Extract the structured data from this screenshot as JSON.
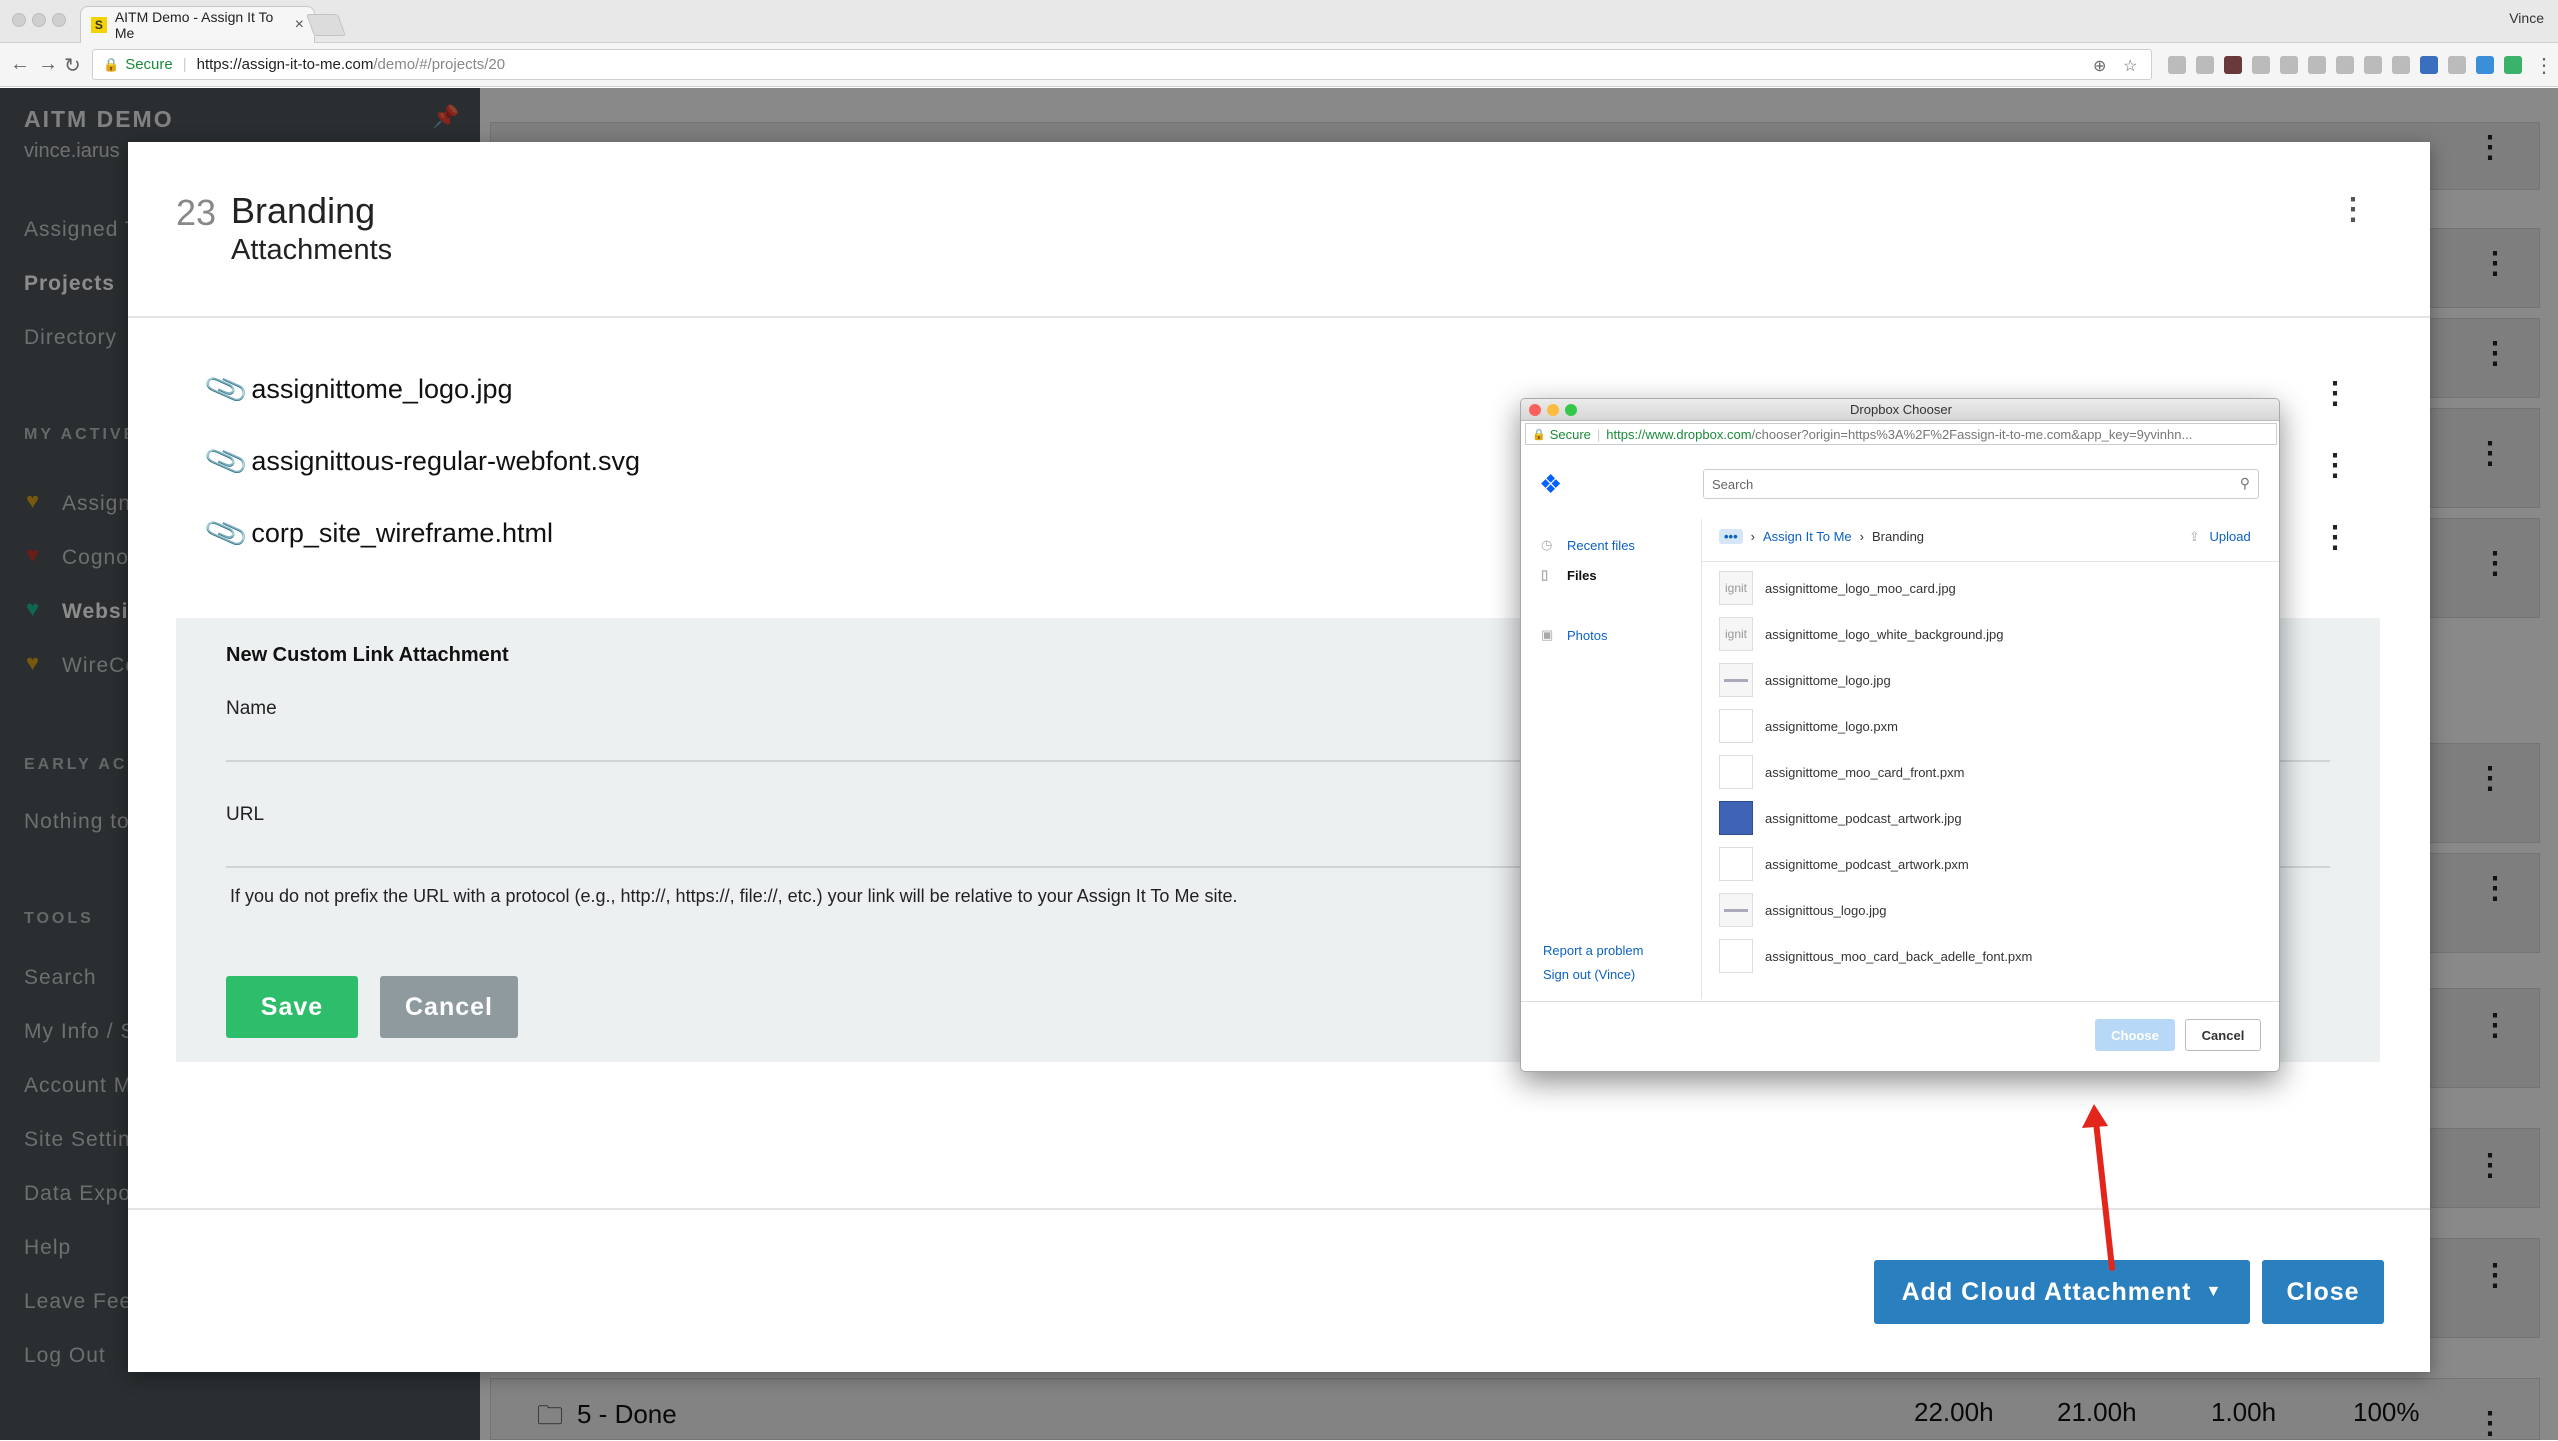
{
  "browser": {
    "tab_title": "AITM Demo - Assign It To Me",
    "tab_favicon": "S",
    "tab_close": "×",
    "profile": "Vince",
    "secure_label": "Secure",
    "url_host": "https://assign-it-to-me.com",
    "url_path": "/demo/#/projects/20"
  },
  "sidebar": {
    "brand": "AITM DEMO",
    "user": "vince.iarus",
    "items": [
      "Assigned T",
      "Projects",
      "Directory"
    ],
    "my_active_heading": "MY ACTIVE",
    "projects": [
      {
        "label": "Assign",
        "color": "#d9a21b"
      },
      {
        "label": "Cogno",
        "color": "#c0392b"
      },
      {
        "label": "Websi",
        "color": "#1abc9c"
      },
      {
        "label": "WireCo",
        "color": "#d9a21b"
      }
    ],
    "early_heading": "EARLY ACC",
    "early_text": "Nothing to",
    "tools_heading": "TOOLS",
    "tools": [
      "Search",
      "My Info / S",
      "Account M",
      "Site Settin",
      "Data Expo",
      "Help",
      "Leave Fee",
      "Log Out"
    ]
  },
  "background": {
    "row_values": [
      "22.00h",
      "21.00h",
      "1.00h",
      "100%"
    ],
    "done_label": "5 - Done"
  },
  "modal": {
    "number": "23",
    "title": "Branding",
    "subtitle": "Attachments",
    "attachments": [
      "assignittome_logo.jpg",
      "assignittous-regular-webfont.svg",
      "corp_site_wireframe.html"
    ],
    "form": {
      "title": "New Custom Link Attachment",
      "name_label": "Name",
      "name_value": "",
      "url_label": "URL",
      "url_value": "",
      "help": "If you do not prefix the URL with a protocol (e.g., http://, https://, file://, etc.) your link will be relative to your Assign It To Me site.",
      "save": "Save",
      "cancel": "Cancel"
    },
    "add_cloud": "Add Cloud Attachment",
    "close": "Close"
  },
  "dropbox": {
    "window_title": "Dropbox Chooser",
    "secure_label": "Secure",
    "url_host": "https://www.dropbox.com",
    "url_path": "/chooser?origin=https%3A%2F%2Fassign-it-to-me.com&app_key=9yvinhn...",
    "search_placeholder": "Search",
    "nav": [
      "Recent files",
      "Files",
      "Photos"
    ],
    "report": "Report a problem",
    "signout": "Sign out (Vince)",
    "crumb_more": "•••",
    "crumb_parent": "Assign It To Me",
    "crumb_current": "Branding",
    "upload": "Upload",
    "files": [
      {
        "name": "assignittome_logo_moo_card.jpg",
        "thumb": "ignit"
      },
      {
        "name": "assignittome_logo_white_background.jpg",
        "thumb": "ignit"
      },
      {
        "name": "assignittome_logo.jpg",
        "thumb": ""
      },
      {
        "name": "assignittome_logo.pxm",
        "thumb": ""
      },
      {
        "name": "assignittome_moo_card_front.pxm",
        "thumb": ""
      },
      {
        "name": "assignittome_podcast_artwork.jpg",
        "thumb": ""
      },
      {
        "name": "assignittome_podcast_artwork.pxm",
        "thumb": ""
      },
      {
        "name": "assignittous_logo.jpg",
        "thumb": ""
      },
      {
        "name": "assignittous_moo_card_back_adelle_font.pxm",
        "thumb": ""
      }
    ],
    "choose": "Choose",
    "cancel": "Cancel"
  }
}
